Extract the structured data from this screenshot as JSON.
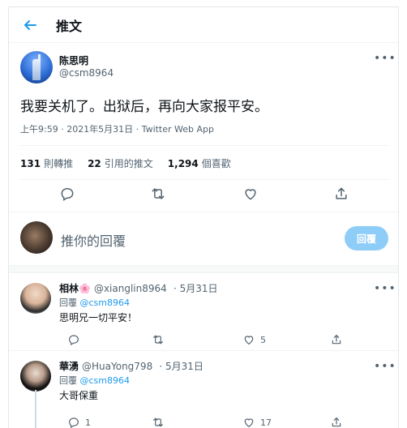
{
  "header": {
    "title": "推文",
    "back_icon": "arrow-left-icon"
  },
  "tweet": {
    "author_name": "陈思明",
    "author_handle": "@csm8964",
    "text": "我要关机了。出狱后，再向大家报平安。",
    "meta": "上午9:59 · 2021年5月31日 · Twitter Web App",
    "stats": {
      "retweets_count": "131",
      "retweets_label": "則轉推",
      "quotes_count": "22",
      "quotes_label": "引用的推文",
      "likes_count": "1,294",
      "likes_label": "個喜歡"
    }
  },
  "compose": {
    "placeholder": "推你的回覆",
    "reply_button": "回覆"
  },
  "replies": [
    {
      "name": "相林🌸",
      "handle": "@xianglin8964",
      "date": "· 5月31日",
      "reply_to_label": "回覆",
      "reply_to_handle": "@csm8964",
      "text": "思明兄一切平安！",
      "likes": "5"
    },
    {
      "name": "華湧",
      "handle": "@HuaYong798",
      "date": "· 5月31日",
      "reply_to_label": "回覆",
      "reply_to_handle": "@csm8964",
      "text": "大哥保重",
      "comments": "1",
      "likes": "17"
    }
  ],
  "colors": {
    "accent": "#1d9bf0",
    "reply_button_disabled": "#8ecdf8",
    "muted": "#536471"
  }
}
